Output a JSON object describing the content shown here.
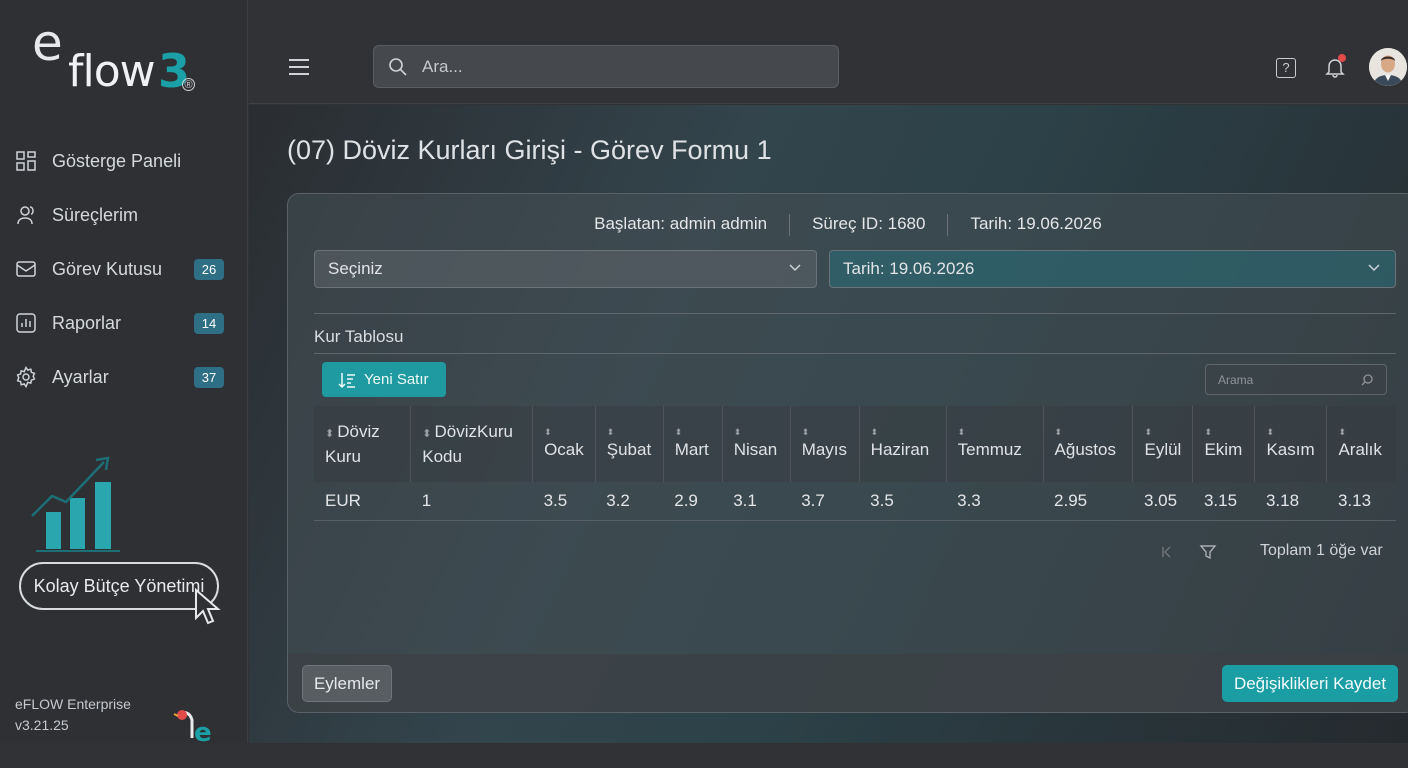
{
  "brand": {
    "logo_e": "e",
    "logo_flow": "flow",
    "logo_3": "3",
    "logo_reg": "®"
  },
  "sidebar": {
    "items": [
      {
        "label": "Gösterge Paneli",
        "icon": "dashboard-icon",
        "badge": ""
      },
      {
        "label": "Süreçlerim",
        "icon": "user-icon",
        "badge": ""
      },
      {
        "label": "Görev Kutusu",
        "icon": "inbox-icon",
        "badge": "26"
      },
      {
        "label": "Raporlar",
        "icon": "report-icon",
        "badge": "14"
      },
      {
        "label": "Ayarlar",
        "icon": "gear-icon",
        "badge": "37"
      }
    ],
    "promo": "Kolay Bütçe Yönetimi",
    "version_name": "eFLOW Enterprise",
    "version": "v3.21.25"
  },
  "header": {
    "search_placeholder": "Ara...",
    "help": "?"
  },
  "page": {
    "title": "(07) Döviz Kurları Girişi - Görev Formu 1"
  },
  "meta": {
    "starter": "Başlatan: admin admin",
    "process_id": "Süreç ID: 1680",
    "date": "Tarih: 19.06.2026"
  },
  "selects": {
    "first": "Seçiniz",
    "second": "Tarih: 19.06.2026"
  },
  "section": {
    "title": "Kur Tablosu",
    "new_row": "Yeni Satır",
    "grid_search_placeholder": "Arama"
  },
  "table": {
    "columns": [
      "Döviz Kuru",
      "DövizKuru Kodu",
      "Ocak",
      "Şubat",
      "Mart",
      "Nisan",
      "Mayıs",
      "Haziran",
      "Temmuz",
      "Ağustos",
      "Eylül",
      "Ekim",
      "Kasım",
      "Aralık"
    ],
    "rows": [
      [
        "EUR",
        "1",
        "3.5",
        "3.2",
        "2.9",
        "3.1",
        "3.7",
        "3.5",
        "3.3",
        "2.95",
        "3.05",
        "3.15",
        "3.18",
        "3.13"
      ]
    ]
  },
  "pager": {
    "total": "Toplam 1 öğe var"
  },
  "footer": {
    "actions": "Eylemler",
    "save": "Değişiklikleri Kaydet"
  },
  "colors": {
    "accent": "#1a9da3",
    "badge": "#2f6f86",
    "notify": "#e34b4b"
  }
}
